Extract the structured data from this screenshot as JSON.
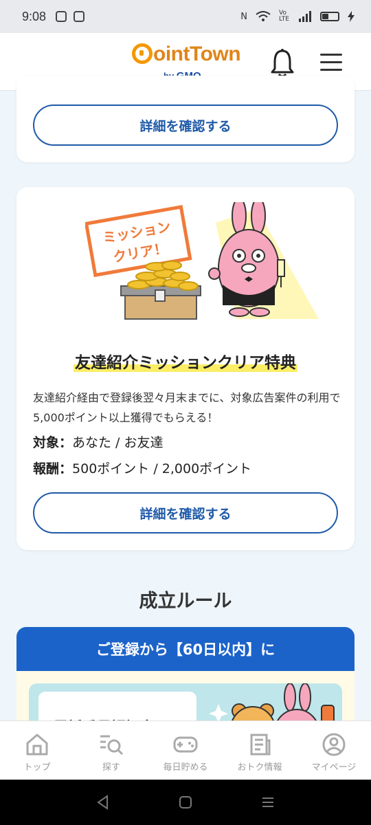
{
  "status_bar": {
    "time": "9:08",
    "network": "Vo LTE"
  },
  "header": {
    "logo_main": "ointTown",
    "logo_sub_by": "by",
    "logo_sub_brand": "GMO"
  },
  "card1": {
    "button_label": "詳細を確認する"
  },
  "card2": {
    "badge_line1": "ミッション",
    "badge_line2": "クリア！",
    "title": "友達紹介ミッションクリア特典",
    "description": "友達紹介経由で登録後翌々月末までに、対象広告案件の利用で5,000ポイント以上獲得でもらえる！",
    "target_label": "対象：",
    "target_value": "あなた / お友達",
    "reward_label": "報酬：",
    "reward_value": "500ポイント / 2,000ポイント",
    "button_label": "詳細を確認する"
  },
  "rules": {
    "section_title": "成立ルール",
    "header": "ご登録から【60日以内】に",
    "step_text": "電話番号認証完了"
  },
  "tab_bar": {
    "items": [
      {
        "label": "トップ",
        "icon": "home-icon"
      },
      {
        "label": "探す",
        "icon": "search-icon"
      },
      {
        "label": "毎日貯める",
        "icon": "gamepad-icon"
      },
      {
        "label": "おトク情報",
        "icon": "news-icon"
      },
      {
        "label": "マイページ",
        "icon": "user-icon"
      }
    ]
  },
  "colors": {
    "brand_orange": "#f39800",
    "brand_blue": "#1f5aa8",
    "highlight_yellow": "#fbee66",
    "rule_header_blue": "#1c63c9"
  }
}
